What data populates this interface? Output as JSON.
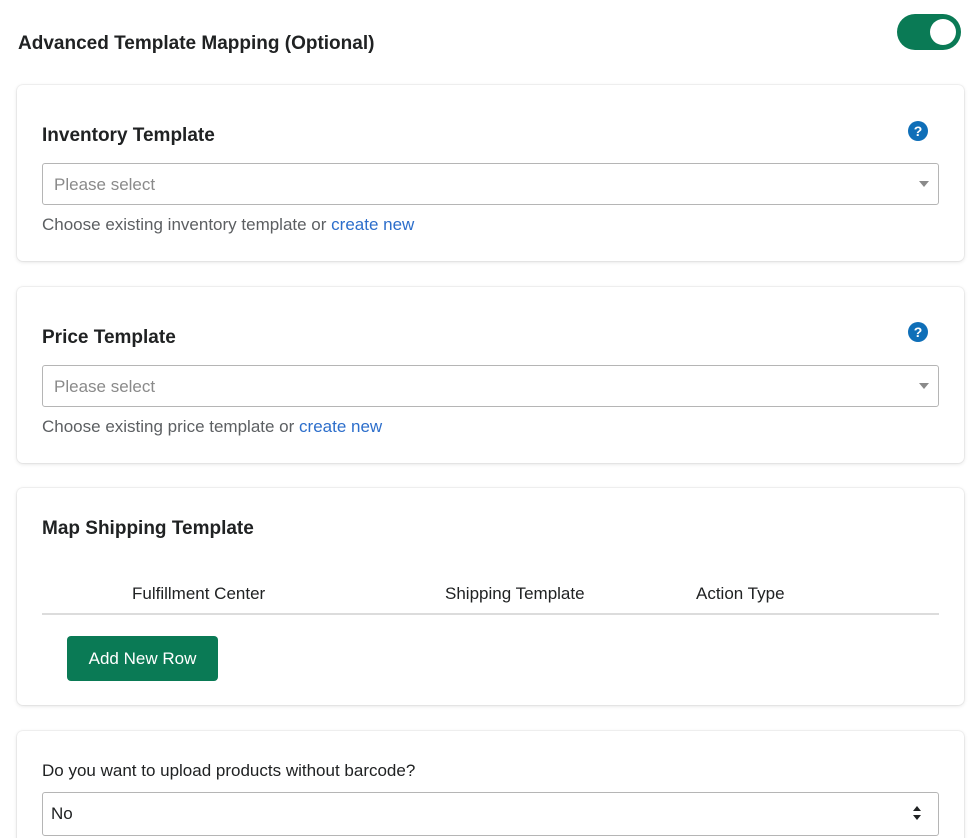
{
  "header": {
    "title": "Advanced Template Mapping (Optional)",
    "toggle_on": true
  },
  "inventory": {
    "title": "Inventory Template",
    "placeholder": "Please select",
    "help_prefix": "Choose existing inventory template or ",
    "help_link": "create new",
    "help_icon": "?"
  },
  "price": {
    "title": "Price Template",
    "placeholder": "Please select",
    "help_prefix": "Choose existing price template or ",
    "help_link": "create new",
    "help_icon": "?"
  },
  "shipping": {
    "title": "Map Shipping Template",
    "columns": [
      "Fulfillment Center",
      "Shipping Template",
      "Action Type"
    ],
    "add_button": "Add New Row"
  },
  "barcode": {
    "question": "Do you want to upload products without barcode?",
    "selected": "No"
  },
  "colors": {
    "accent_green": "#0a7a55",
    "link_blue": "#2c6ecb",
    "help_icon_blue": "#0f6fb8"
  }
}
